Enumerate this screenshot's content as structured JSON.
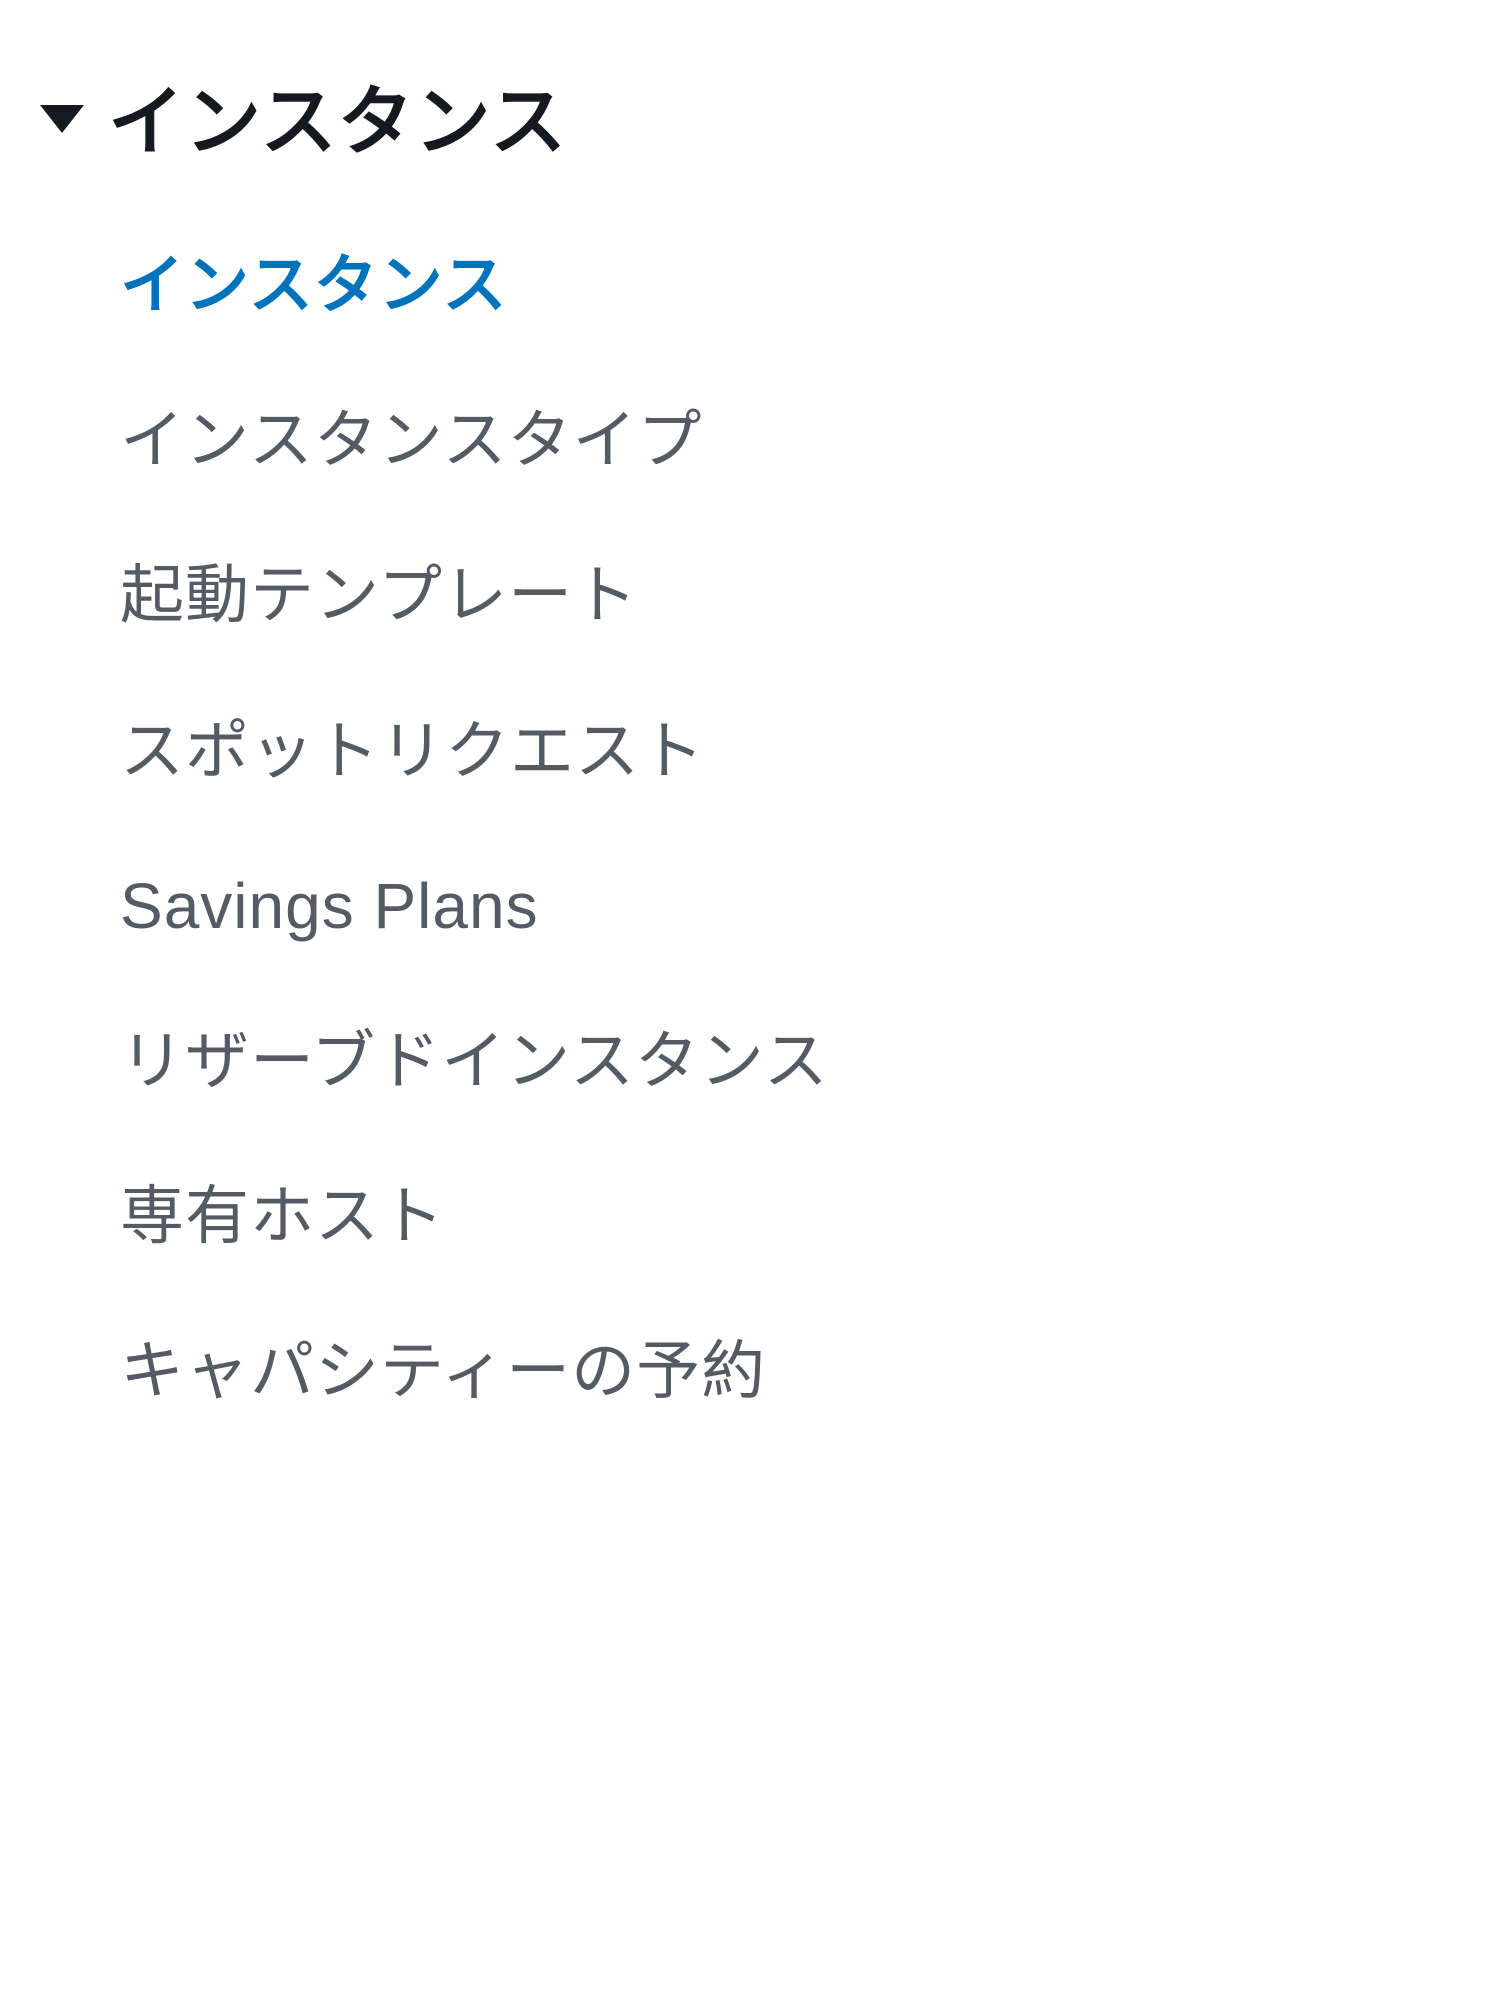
{
  "sidebar": {
    "section": {
      "header": "インスタンス",
      "expanded": true,
      "items": [
        {
          "label": "インスタンス",
          "active": true
        },
        {
          "label": "インスタンスタイプ",
          "active": false
        },
        {
          "label": "起動テンプレート",
          "active": false
        },
        {
          "label": "スポットリクエスト",
          "active": false
        },
        {
          "label": "Savings Plans",
          "active": false
        },
        {
          "label": "リザーブドインスタンス",
          "active": false
        },
        {
          "label": "専有ホスト",
          "active": false
        },
        {
          "label": "キャパシティーの予約",
          "active": false
        }
      ]
    }
  }
}
